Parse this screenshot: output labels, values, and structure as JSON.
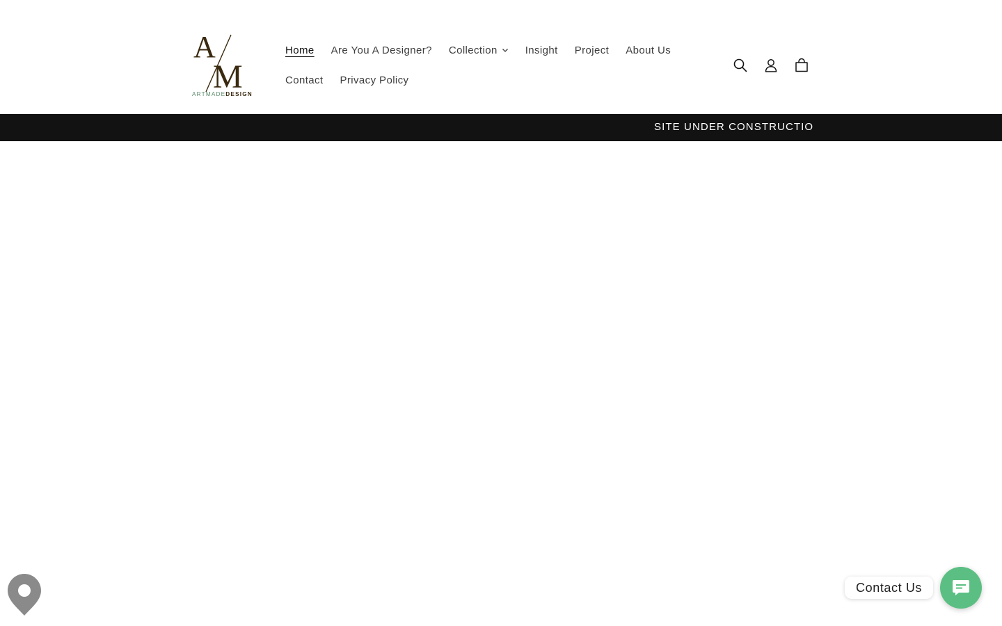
{
  "brand": {
    "logo_monogram_top": "A",
    "logo_monogram_bottom": "M",
    "logo_wordmark_part1": "ARTMADE",
    "logo_wordmark_part2": "DESIGN",
    "logo_color": "#3a2a10",
    "wordmark_accent_color": "#5b8a6a"
  },
  "nav": {
    "row1": [
      {
        "label": "Home",
        "active": true
      },
      {
        "label": "Are You A Designer?"
      },
      {
        "label": "Collection",
        "has_dropdown": true,
        "icon": "chevron-down-icon"
      },
      {
        "label": "Insight"
      },
      {
        "label": "Project"
      },
      {
        "label": "About Us"
      }
    ],
    "row2": [
      {
        "label": "Contact"
      },
      {
        "label": "Privacy Policy"
      }
    ]
  },
  "header_icons": [
    "search-icon",
    "account-icon",
    "cart-icon"
  ],
  "announcement": {
    "text": "SITE UNDER CONSTRUCTION",
    "background": "#121212",
    "color": "#ffffff"
  },
  "widgets": {
    "map_pin_icon": "map-pin-icon",
    "map_pin_color": "#8a8a8a",
    "contact_label": "Contact Us",
    "contact_button_color": "#5bbf83",
    "contact_button_icon": "chat-icon"
  }
}
